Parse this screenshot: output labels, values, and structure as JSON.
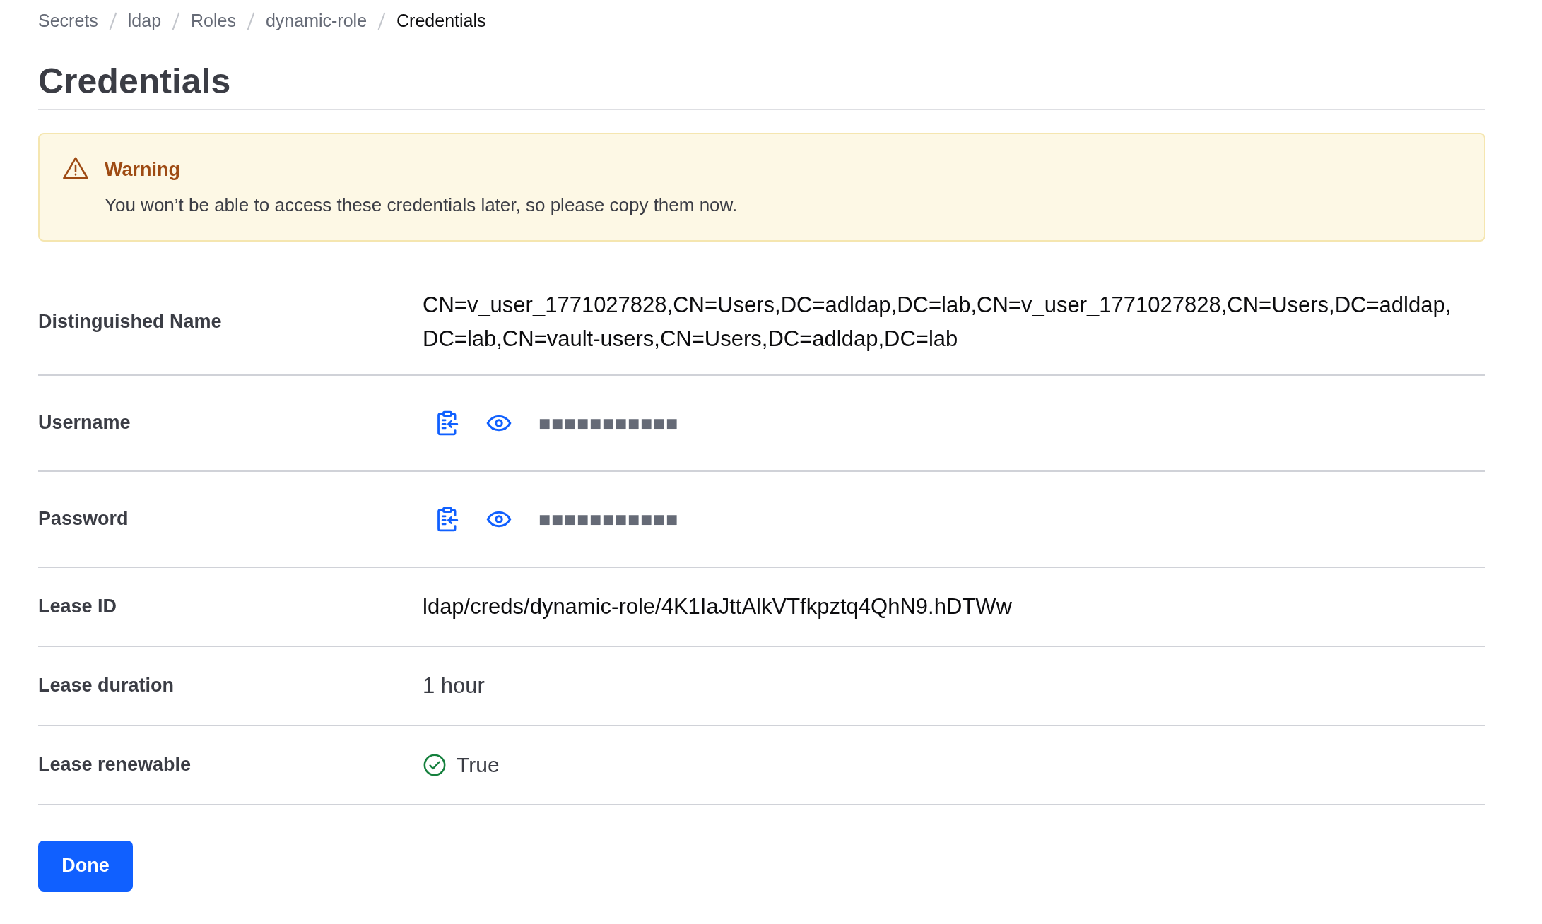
{
  "breadcrumbs": [
    {
      "label": "Secrets",
      "current": false
    },
    {
      "label": "ldap",
      "current": false
    },
    {
      "label": "Roles",
      "current": false
    },
    {
      "label": "dynamic-role",
      "current": false
    },
    {
      "label": "Credentials",
      "current": true
    }
  ],
  "title": "Credentials",
  "alert": {
    "title": "Warning",
    "message": "You won’t be able to access these credentials later, so please copy them now."
  },
  "fields": [
    {
      "kind": "text",
      "label": "Distinguished Name",
      "value": "CN=v_user_1771027828,CN=Users,DC=adldap,DC=lab,CN=v_user_1771027828,CN=Users,DC=adldap,DC=lab,CN=vault-users,CN=Users,DC=adldap,DC=lab"
    },
    {
      "kind": "masked",
      "label": "Username",
      "value": "■■■■■■■■■■■"
    },
    {
      "kind": "masked",
      "label": "Password",
      "value": "■■■■■■■■■■■"
    },
    {
      "kind": "text",
      "label": "Lease ID",
      "value": "ldap/creds/dynamic-role/4K1IaJttAlkVTfkpztq4QhN9.hDTWw"
    },
    {
      "kind": "plain",
      "label": "Lease duration",
      "value": "1 hour"
    },
    {
      "kind": "boolean",
      "label": "Lease renewable",
      "value": "True",
      "on": true
    }
  ],
  "done_button": "Done"
}
